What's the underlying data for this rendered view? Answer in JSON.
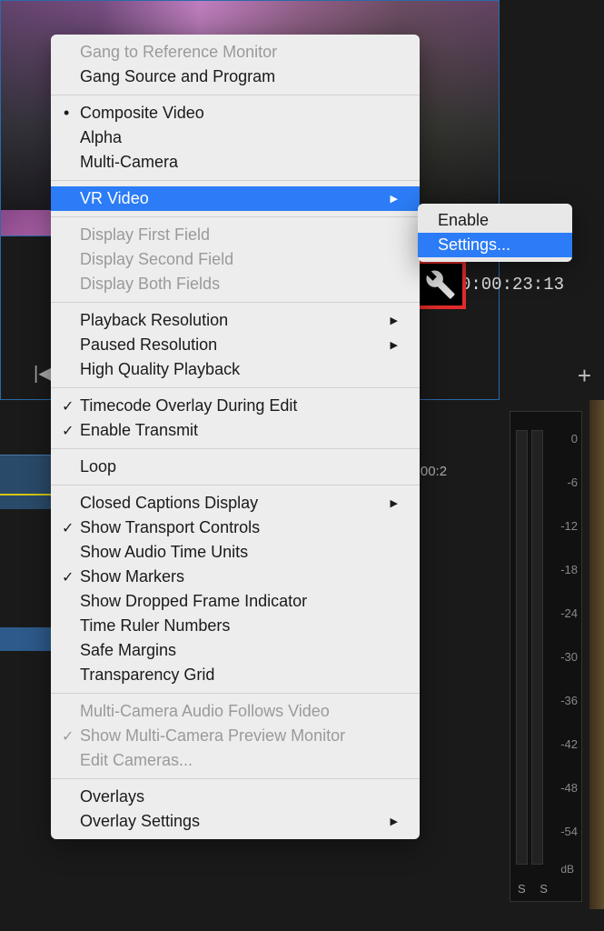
{
  "timecode_main": "00:00:23:13",
  "timecode_small": "00:00:2",
  "menu": {
    "gang_ref": "Gang to Reference Monitor",
    "gang_src": "Gang Source and Program",
    "composite": "Composite Video",
    "alpha": "Alpha",
    "multicam": "Multi-Camera",
    "vr_video": "VR Video",
    "disp_first": "Display First Field",
    "disp_second": "Display Second Field",
    "disp_both": "Display Both Fields",
    "play_res": "Playback Resolution",
    "pause_res": "Paused Resolution",
    "hq_play": "High Quality Playback",
    "tc_overlay": "Timecode Overlay During Edit",
    "en_transmit": "Enable Transmit",
    "loop": "Loop",
    "cc_display": "Closed Captions Display",
    "show_transport": "Show Transport Controls",
    "show_audio_units": "Show Audio Time Units",
    "show_markers": "Show Markers",
    "show_dropped": "Show Dropped Frame Indicator",
    "time_ruler": "Time Ruler Numbers",
    "safe_margins": "Safe Margins",
    "transparency": "Transparency Grid",
    "mc_audio": "Multi-Camera Audio Follows Video",
    "mc_preview": "Show Multi-Camera Preview Monitor",
    "edit_cams": "Edit Cameras...",
    "overlays": "Overlays",
    "overlay_settings": "Overlay Settings"
  },
  "submenu": {
    "enable": "Enable",
    "settings": "Settings..."
  },
  "meter": {
    "ticks": [
      "0",
      "-6",
      "-12",
      "-18",
      "-24",
      "-30",
      "-36",
      "-42",
      "-48",
      "-54"
    ],
    "db": "dB",
    "ss": "S S"
  }
}
